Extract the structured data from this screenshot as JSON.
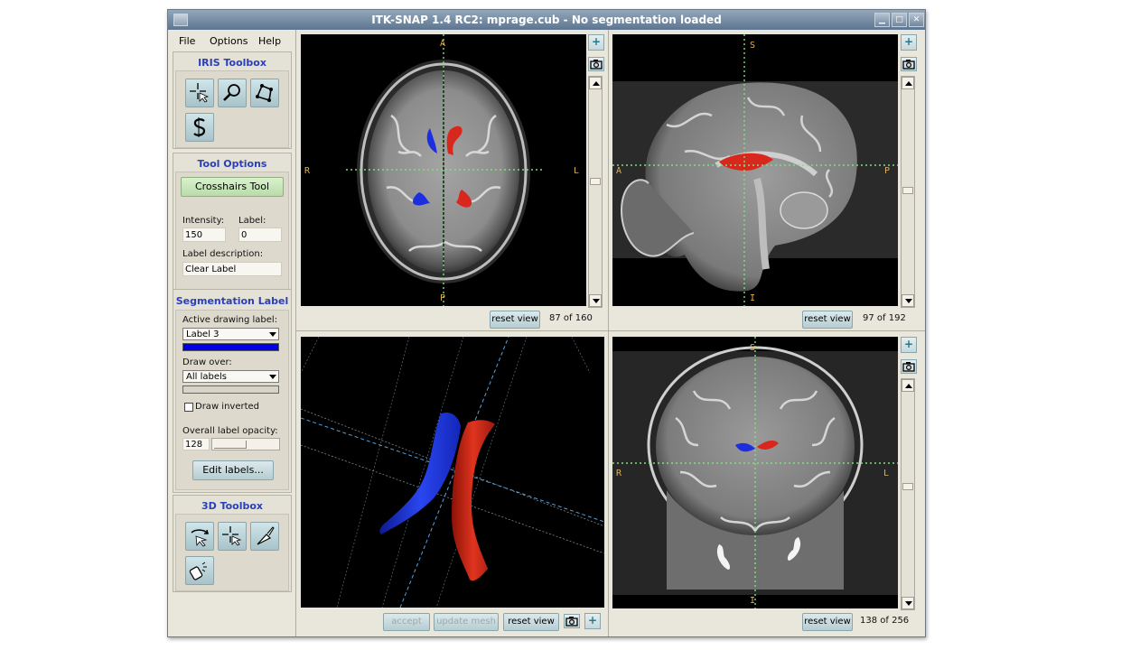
{
  "window": {
    "title": "ITK-SNAP 1.4 RC2: mprage.cub - No segmentation loaded"
  },
  "menu": [
    {
      "label": "File"
    },
    {
      "label": "Options"
    },
    {
      "label": "Help"
    }
  ],
  "iris_toolbox": {
    "title": "IRIS Toolbox",
    "tools": [
      "crosshairs-icon",
      "zoom-icon",
      "polygon-icon",
      "snake-icon"
    ]
  },
  "tool_options": {
    "title": "Tool Options",
    "tool_name": "Crosshairs Tool",
    "intensity_label": "Intensity:",
    "intensity_value": "150",
    "label_label": "Label:",
    "label_value": "0",
    "description_label": "Label description:",
    "description_value": "Clear Label"
  },
  "segmentation_label": {
    "title": "Segmentation Label",
    "active_label_caption": "Active drawing label:",
    "active_label": "Label 3",
    "active_label_color": "#0000e0",
    "draw_over_caption": "Draw over:",
    "draw_over": "All labels",
    "draw_inverted": "Draw inverted",
    "opacity_caption": "Overall label opacity:",
    "opacity_value": "128",
    "edit_labels": "Edit labels..."
  },
  "toolbox_3d": {
    "title": "3D Toolbox",
    "tools": [
      "rotate-icon",
      "crosshair-3d-icon",
      "scalpel-icon",
      "spray-icon"
    ]
  },
  "views": {
    "axial": {
      "top": "A",
      "bottom": "P",
      "left": "R",
      "right": "L",
      "reset": "reset view",
      "slice": "87 of 160"
    },
    "sagittal": {
      "top": "S",
      "bottom": "I",
      "left": "A",
      "right": "P",
      "reset": "reset view",
      "slice": "97 of 192"
    },
    "coronal": {
      "top": "S",
      "bottom": "I",
      "left": "R",
      "right": "L",
      "reset": "reset view",
      "slice": "138 of 256"
    },
    "render3d": {
      "accept": "accept",
      "update_mesh": "update mesh",
      "reset": "reset view"
    }
  },
  "colors": {
    "crosshair": "#7ee07e",
    "label_red": "#d8281e",
    "label_blue": "#1c2ee0",
    "orient": "#e4b050"
  }
}
